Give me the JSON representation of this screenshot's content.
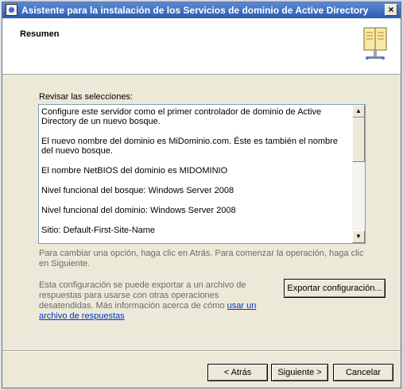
{
  "window": {
    "title": "Asistente para la instalación de los Servicios de dominio de Active Directory",
    "close_label": "×"
  },
  "header": {
    "title": "Resumen",
    "icon": "book-icon"
  },
  "review": {
    "label": "Revisar las selecciones:",
    "lines": [
      "Configure este servidor como el primer controlador de dominio de Active Directory de un nuevo bosque.",
      "El nuevo nombre del dominio es MiDominio.com. Éste es también el nombre del nuevo bosque.",
      "El nombre NetBIOS del dominio es MIDOMINIO",
      "Nivel funcional del bosque: Windows Server 2008",
      "Nivel funcional del dominio: Windows Server 2008",
      "Sitio: Default-First-Site-Name"
    ]
  },
  "hint": "Para cambiar una opción, haga clic en Atrás. Para comenzar la operación, haga clic en Siguiente.",
  "export": {
    "text": "Esta configuración se puede exportar a un archivo de respuestas para usarse con otras operaciones desatendidas. Más información acerca de cómo",
    "link": "usar un archivo de respuestas",
    "button": "Exportar configuración..."
  },
  "buttons": {
    "back": "< Atrás",
    "next": "Siguiente >",
    "cancel": "Cancelar"
  }
}
